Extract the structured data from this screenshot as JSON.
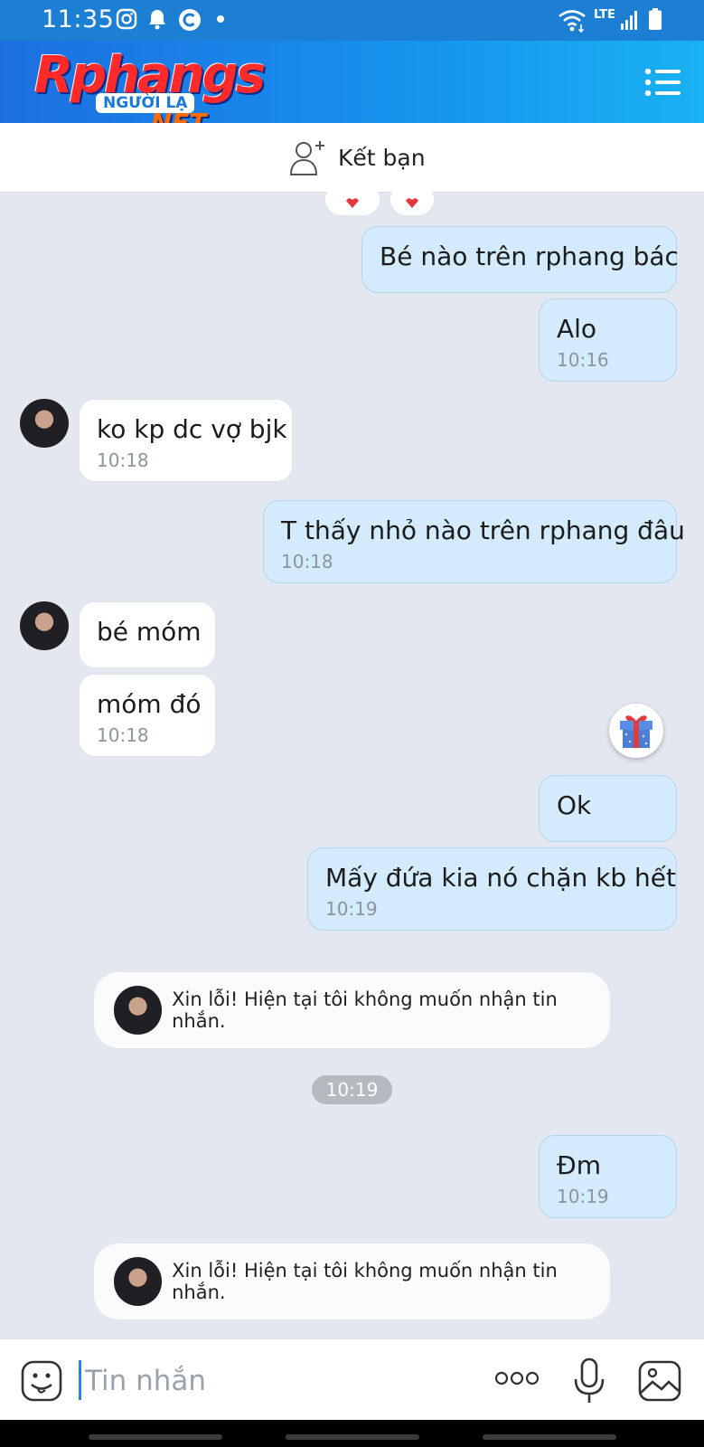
{
  "status_bar": {
    "time": "11:35",
    "network": "LTE"
  },
  "header": {
    "logo": {
      "text": "Rphangs",
      "tagline": "NGƯỜI LẠ",
      "suffix": ".NET"
    }
  },
  "friend_action": {
    "label": "Kết bạn"
  },
  "messages": [
    {
      "side": "out",
      "text": "Bé nào trên rphang bác",
      "time": ""
    },
    {
      "side": "out",
      "text": "Alo",
      "time": "10:16"
    },
    {
      "side": "in",
      "text": "ko kp dc vợ bjk",
      "time": "10:18"
    },
    {
      "side": "out",
      "text": "T thấy nhỏ nào trên rphang đâu",
      "time": "10:18"
    },
    {
      "side": "in",
      "text": "bé móm",
      "time": ""
    },
    {
      "side": "in",
      "text": "móm đó",
      "time": "10:18"
    },
    {
      "side": "out",
      "text": "Ok",
      "time": ""
    },
    {
      "side": "out",
      "text": "Mấy đứa kia nó chặn kb hết",
      "time": "10:19"
    },
    {
      "side": "system",
      "text": "Xin lỗi! Hiện tại tôi không muốn nhận tin nhắn."
    },
    {
      "side": "divider",
      "text": "10:19"
    },
    {
      "side": "out",
      "text": "Đm",
      "time": "10:19"
    },
    {
      "side": "system",
      "text": "Xin lỗi! Hiện tại tôi không muốn nhận tin nhắn."
    }
  ],
  "input": {
    "placeholder": "Tin nhắn",
    "value": ""
  },
  "icons": {
    "status": [
      "instagram-icon",
      "notification-bell-icon",
      "app-c-icon",
      "dot-icon",
      "wifi-icon",
      "signal-icon",
      "battery-icon"
    ],
    "header": [
      "back-icon",
      "menu-icon"
    ],
    "input": [
      "emoji-icon",
      "more-icon",
      "microphone-icon",
      "image-icon"
    ]
  },
  "colors": {
    "header_gradient_start": "#1c6fe0",
    "header_gradient_end": "#19b2f3",
    "chat_background": "#e3e8f0",
    "outgoing_bubble": "#d3ebfd",
    "incoming_bubble": "#ffffff",
    "caret": "#2a83d8"
  }
}
